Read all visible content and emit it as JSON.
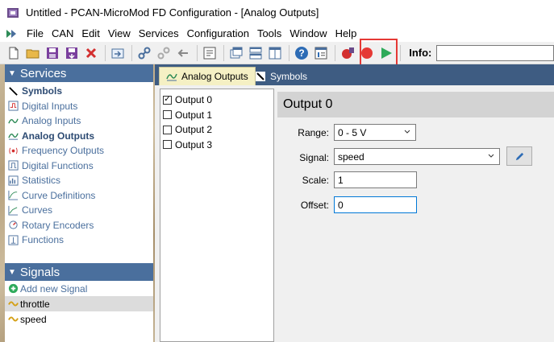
{
  "window": {
    "title": "Untitled - PCAN-MicroMod FD Configuration - [Analog Outputs]"
  },
  "menu": {
    "items": [
      "File",
      "CAN",
      "Edit",
      "View",
      "Services",
      "Configuration",
      "Tools",
      "Window",
      "Help"
    ]
  },
  "toolbar": {
    "info_label": "Info:",
    "info_value": ""
  },
  "services": {
    "header": "Services",
    "items": [
      {
        "label": "Symbols",
        "icon": "symbols-icon",
        "bold": true
      },
      {
        "label": "Digital Inputs",
        "icon": "digital-inputs-icon",
        "bold": false
      },
      {
        "label": "Analog Inputs",
        "icon": "analog-inputs-icon",
        "bold": false
      },
      {
        "label": "Analog Outputs",
        "icon": "analog-outputs-icon",
        "bold": true
      },
      {
        "label": "Frequency Outputs",
        "icon": "frequency-outputs-icon",
        "bold": false
      },
      {
        "label": "Digital Functions",
        "icon": "digital-functions-icon",
        "bold": false
      },
      {
        "label": "Statistics",
        "icon": "statistics-icon",
        "bold": false
      },
      {
        "label": "Curve Definitions",
        "icon": "curve-definitions-icon",
        "bold": false
      },
      {
        "label": "Curves",
        "icon": "curves-icon",
        "bold": false
      },
      {
        "label": "Rotary Encoders",
        "icon": "rotary-encoders-icon",
        "bold": false
      },
      {
        "label": "Functions",
        "icon": "functions-icon",
        "bold": false
      }
    ]
  },
  "signals": {
    "header": "Signals",
    "add_label": "Add new Signal",
    "items": [
      {
        "label": "throttle",
        "selected": true
      },
      {
        "label": "speed",
        "selected": false
      }
    ]
  },
  "tabs": [
    {
      "label": "Analog Outputs",
      "active": true
    },
    {
      "label": "Symbols",
      "active": false
    }
  ],
  "outputs": [
    {
      "label": "Output 0",
      "checked": true
    },
    {
      "label": "Output 1",
      "checked": false
    },
    {
      "label": "Output 2",
      "checked": false
    },
    {
      "label": "Output 3",
      "checked": false
    }
  ],
  "detail": {
    "title": "Output 0",
    "range_label": "Range:",
    "range_value": "0 - 5 V",
    "signal_label": "Signal:",
    "signal_value": "speed",
    "scale_label": "Scale:",
    "scale_value": "1",
    "offset_label": "Offset:",
    "offset_value": "0"
  },
  "colors": {
    "panel_header": "#4a6f9d",
    "tab_strip": "#3e5c82",
    "active_tab": "#f5f0c4",
    "highlight": "#e53935",
    "play": "#2eaa5a"
  }
}
